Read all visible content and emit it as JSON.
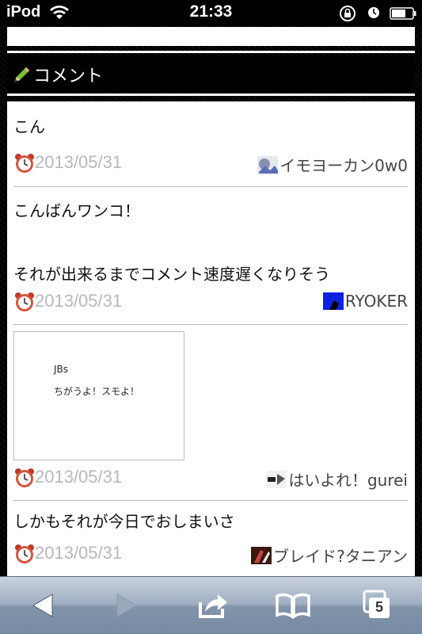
{
  "status_bar": {
    "carrier": "iPod",
    "time": "21:33"
  },
  "header": {
    "title": "コメント"
  },
  "comments": [
    {
      "text": "こん",
      "date": "2013/05/31",
      "author": "イモヨーカン0w0"
    },
    {
      "text": "こんばんワンコ！\n\nそれが出来るまでコメント速度遅くなりそう",
      "date": "2013/05/31",
      "author": "RYOKER"
    },
    {
      "text": "",
      "image_text": [
        "JBs",
        "ちがうよ！スモよ！"
      ],
      "date": "2013/05/31",
      "author": "はいよれ！gurei"
    },
    {
      "text": "しかもそれが今日でおしまいさ",
      "date": "2013/05/31",
      "author": "ブレイド?タニアン"
    }
  ],
  "toolbar": {
    "tabs_count": "5"
  },
  "colors": {
    "toolbar_top": "#c9d2dd",
    "toolbar_bottom": "#768aa2",
    "date_gray": "#b8b8b8"
  },
  "icons": [
    "wifi-icon",
    "rotation-lock-icon",
    "clock-icon",
    "battery-icon",
    "pencil-icon",
    "alarm-clock-icon",
    "back-icon",
    "forward-icon",
    "share-icon",
    "bookmarks-icon",
    "tabs-icon"
  ]
}
